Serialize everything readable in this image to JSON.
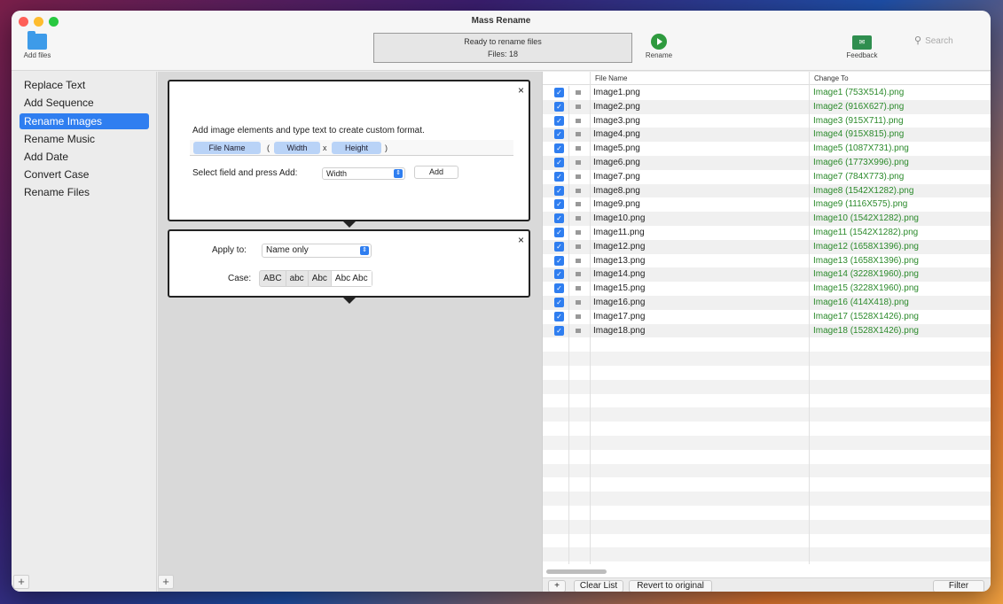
{
  "window": {
    "title": "Mass Rename"
  },
  "toolbar": {
    "add_files": "Add files",
    "status_line1": "Ready to rename files",
    "status_line2": "Files: 18",
    "rename": "Rename",
    "feedback": "Feedback",
    "search_placeholder": "Search"
  },
  "sidebar": {
    "items": [
      {
        "label": "Replace Text"
      },
      {
        "label": "Add Sequence"
      },
      {
        "label": "Rename Images",
        "active": true
      },
      {
        "label": "Rename Music"
      },
      {
        "label": "Add Date"
      },
      {
        "label": "Convert Case"
      },
      {
        "label": "Rename Files"
      }
    ],
    "plus": "+"
  },
  "image_panel": {
    "hint": "Add image elements and type text to create custom format.",
    "tokens": {
      "file_name": "File Name",
      "open_paren": "(",
      "width": "Width",
      "x": "x",
      "height": "Height",
      "close_paren": ")"
    },
    "select_label": "Select field and press Add:",
    "field_value": "Width",
    "add_label": "Add",
    "close": "×"
  },
  "case_panel": {
    "apply_label": "Apply to:",
    "apply_value": "Name only",
    "case_label": "Case:",
    "case_options": [
      "ABC",
      "abc",
      "Abc",
      "Abc Abc"
    ],
    "close": "×"
  },
  "middle": {
    "plus": "+"
  },
  "table": {
    "col_file_name": "File Name",
    "col_change_to": "Change To",
    "rows": [
      {
        "file": "Image1.png",
        "change": "Image1 (753X514).png"
      },
      {
        "file": "Image2.png",
        "change": "Image2 (916X627).png"
      },
      {
        "file": "Image3.png",
        "change": "Image3 (915X711).png"
      },
      {
        "file": "Image4.png",
        "change": "Image4 (915X815).png"
      },
      {
        "file": "Image5.png",
        "change": "Image5 (1087X731).png"
      },
      {
        "file": "Image6.png",
        "change": "Image6 (1773X996).png"
      },
      {
        "file": "Image7.png",
        "change": "Image7 (784X773).png"
      },
      {
        "file": "Image8.png",
        "change": "Image8 (1542X1282).png"
      },
      {
        "file": "Image9.png",
        "change": "Image9 (1116X575).png"
      },
      {
        "file": "Image10.png",
        "change": "Image10 (1542X1282).png"
      },
      {
        "file": "Image11.png",
        "change": "Image11 (1542X1282).png"
      },
      {
        "file": "Image12.png",
        "change": "Image12 (1658X1396).png"
      },
      {
        "file": "Image13.png",
        "change": "Image13 (1658X1396).png"
      },
      {
        "file": "Image14.png",
        "change": "Image14 (3228X1960).png"
      },
      {
        "file": "Image15.png",
        "change": "Image15 (3228X1960).png"
      },
      {
        "file": "Image16.png",
        "change": "Image16 (414X418).png"
      },
      {
        "file": "Image17.png",
        "change": "Image17 (1528X1426).png"
      },
      {
        "file": "Image18.png",
        "change": "Image18 (1528X1426).png"
      }
    ]
  },
  "bottom": {
    "plus": "+",
    "clear_list": "Clear List",
    "revert": "Revert to original",
    "filter": "Filter"
  }
}
